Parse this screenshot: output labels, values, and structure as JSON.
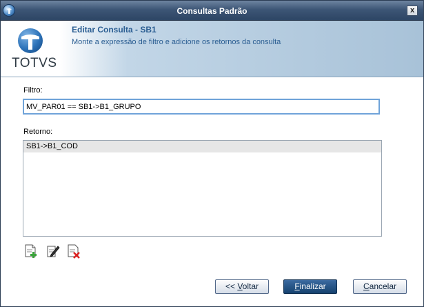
{
  "window": {
    "title": "Consultas Padrão",
    "close_label": "x"
  },
  "header": {
    "logo_text": "TOTVS",
    "title": "Editar Consulta - SB1",
    "subtitle": "Monte a expressão de filtro e adicione os retornos da consulta"
  },
  "filtro": {
    "label": "Filtro:",
    "value": "MV_PAR01 == SB1->B1_GRUPO"
  },
  "retorno": {
    "label": "Retorno:",
    "items": [
      "SB1->B1_COD"
    ]
  },
  "buttons": {
    "voltar_prefix": "<< ",
    "voltar_underlined": "V",
    "voltar_rest": "oltar",
    "finalizar_underlined": "F",
    "finalizar_rest": "inalizar",
    "cancelar_underlined": "C",
    "cancelar_rest": "ancelar"
  },
  "icons": {
    "add": "document-add-icon",
    "edit": "document-edit-icon",
    "delete": "document-delete-icon"
  },
  "colors": {
    "titlebar": "#3d5676",
    "accent_text": "#2b5e92",
    "primary_button": "#16426f"
  }
}
